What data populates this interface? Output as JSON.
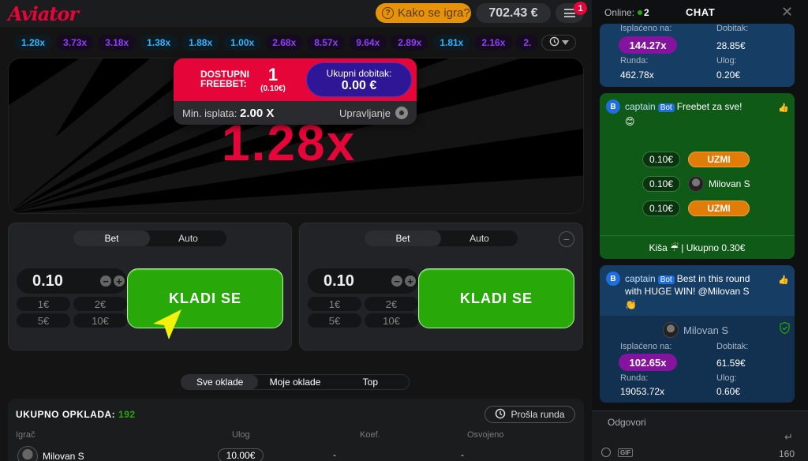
{
  "header": {
    "logo": "Aviator",
    "how_to_play": "Kako se igra?",
    "balance": "702.43 €",
    "notification_count": "1"
  },
  "multiplier_history": [
    {
      "value": "1.28x",
      "color": "blue"
    },
    {
      "value": "3.73x",
      "color": "purple"
    },
    {
      "value": "3.18x",
      "color": "purple"
    },
    {
      "value": "1.38x",
      "color": "blue"
    },
    {
      "value": "1.88x",
      "color": "blue"
    },
    {
      "value": "1.00x",
      "color": "blue"
    },
    {
      "value": "2.68x",
      "color": "purple"
    },
    {
      "value": "8.57x",
      "color": "purple"
    },
    {
      "value": "9.64x",
      "color": "purple"
    },
    {
      "value": "2.89x",
      "color": "purple"
    },
    {
      "value": "1.81x",
      "color": "blue"
    },
    {
      "value": "2.16x",
      "color": "purple"
    },
    {
      "value": "2.",
      "color": "purple"
    }
  ],
  "game": {
    "current_multiplier": "1.28x",
    "freebet": {
      "label_line1": "DOSTUPNI",
      "label_line2": "FREEBET:",
      "count": "1",
      "amount": "(0.10€)",
      "total_label": "Ukupni dobitak:",
      "total_value": "0.00 €",
      "min_payout_label": "Min. isplata:",
      "min_payout_value": "2.00 X",
      "manage_label": "Upravljanje"
    }
  },
  "bet_panels": [
    {
      "tab_bet": "Bet",
      "tab_auto": "Auto",
      "amount": "0.10",
      "quick": [
        "1€",
        "2€",
        "5€",
        "10€"
      ],
      "button": "KLADI SE"
    },
    {
      "tab_bet": "Bet",
      "tab_auto": "Auto",
      "amount": "0.10",
      "quick": [
        "1€",
        "2€",
        "5€",
        "10€"
      ],
      "button": "KLADI SE"
    }
  ],
  "bets": {
    "tabs": [
      "Sve oklade",
      "Moje oklade",
      "Top"
    ],
    "total_label": "UKUPNO OPKLADA:",
    "total_count": "192",
    "prev_round": "Prošla runda",
    "columns": [
      "Igrač",
      "Ulog",
      "Koef.",
      "Osvojeno"
    ],
    "rows": [
      {
        "player": "Milovan S",
        "bet": "10.00€",
        "coef": "-",
        "won": "-"
      }
    ]
  },
  "chat": {
    "online_label": "Online:",
    "online_count": "2",
    "title": "CHAT",
    "top_card": {
      "payout_label": "Isplaćeno na:",
      "payout_value": "144.27x",
      "win_label": "Dobitak:",
      "win_value": "28.85€",
      "round_label": "Runda:",
      "round_value": "462.78x",
      "stake_label": "Ulog:",
      "stake_value": "0.20€"
    },
    "freebet_msg": {
      "bot_name": "captain",
      "bot_tag": "Bot",
      "text": "Freebet za sve!",
      "emoji": "😊",
      "offers": [
        {
          "amount": "0.10€",
          "action": "UZMI",
          "taken_by": ""
        },
        {
          "amount": "0.10€",
          "action": "",
          "taken_by": "Milovan S"
        },
        {
          "amount": "0.10€",
          "action": "UZMI",
          "taken_by": ""
        }
      ],
      "footer": "Kiša ☔ | Ukupno 0.30€"
    },
    "win_msg": {
      "bot_name": "captain",
      "bot_tag": "Bot",
      "text_line1": "Best in this round",
      "text_line2": "with HUGE WIN! @Milovan S",
      "emoji": "👏",
      "user": "Milovan S",
      "payout_label": "Isplaćeno na:",
      "payout_value": "102.65x",
      "win_label": "Dobitak:",
      "win_value": "61.59€",
      "round_label": "Runda:",
      "round_value": "19053.72x",
      "stake_label": "Ulog:",
      "stake_value": "0.60€"
    },
    "reply_placeholder": "Odgovori",
    "char_count": "160"
  },
  "colors": {
    "accent_red": "#e50539",
    "bet_green": "#28a909",
    "chip_blue": "#34b4ff",
    "chip_purple": "#913ef8",
    "orange": "#e69308"
  }
}
